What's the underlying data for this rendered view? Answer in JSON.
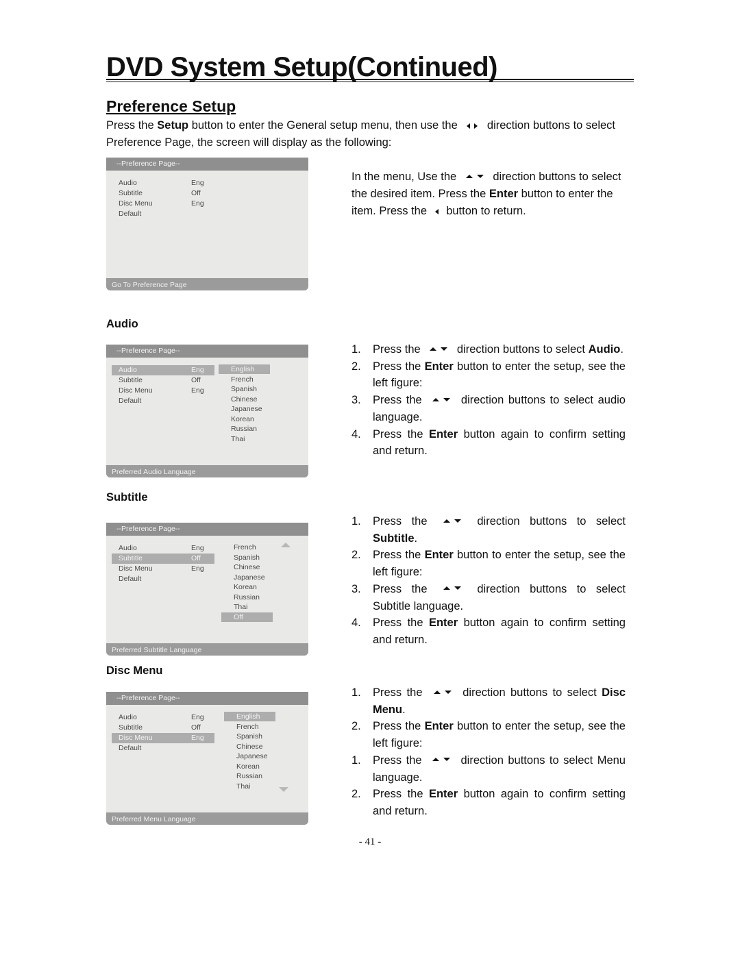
{
  "page_title": "DVD System Setup(Continued)",
  "section_title": "Preference Setup",
  "intro": {
    "part1": "Press the ",
    "bold1": "Setup",
    "part2": " button to enter the General setup menu, then use the ",
    "part3": " direction buttons to select Preference Page, the screen will display as the following:"
  },
  "right_para": {
    "part1": "In the menu, Use the ",
    "part2": " direction buttons to select the desired item. Press the ",
    "bold1": "Enter",
    "part3": " button to enter the item. Press the ",
    "part4": " button to return."
  },
  "osd_common": {
    "header": "--Preference Page--",
    "items": [
      {
        "label": "Audio",
        "value": "Eng"
      },
      {
        "label": "Subtitle",
        "value": "Off"
      },
      {
        "label": "Disc Menu",
        "value": "Eng"
      },
      {
        "label": "Default",
        "value": ""
      }
    ]
  },
  "screens": {
    "main": {
      "footer": "Go To Preference Page"
    },
    "audio": {
      "footer": "Preferred Audio Language",
      "selected_item": "Audio",
      "options": [
        "English",
        "French",
        "Spanish",
        "Chinese",
        "Japanese",
        "Korean",
        "Russian",
        "Thai"
      ],
      "selected_option": "English"
    },
    "subtitle": {
      "footer": "Preferred Subtitle Language",
      "selected_item": "Subtitle",
      "options": [
        "French",
        "Spanish",
        "Chinese",
        "Japanese",
        "Korean",
        "Russian",
        "Thai",
        "Off"
      ],
      "selected_option": "Off",
      "scroll_indicator": "scroll-up"
    },
    "disc_menu": {
      "footer": "Preferred Menu Language",
      "selected_item": "Disc Menu",
      "options": [
        "English",
        "French",
        "Spanish",
        "Chinese",
        "Japanese",
        "Korean",
        "Russian",
        "Thai"
      ],
      "selected_option": "English",
      "scroll_indicator": "scroll-down"
    }
  },
  "sections": {
    "audio": {
      "heading": "Audio",
      "steps": [
        {
          "num": "1.",
          "a": "Press the ",
          "arrows": true,
          "b": " direction buttons to select ",
          "bold": "Audio",
          "c": "."
        },
        {
          "num": "2.",
          "a": "Press the ",
          "bold": "Enter",
          "c": " button to enter the setup, see the left figure:"
        },
        {
          "num": "3.",
          "a": "Press the ",
          "arrows": true,
          "b": " direction buttons to select audio language."
        },
        {
          "num": "4.",
          "a": "Press the ",
          "bold": "Enter",
          "c": " button again to confirm setting and return."
        }
      ]
    },
    "subtitle": {
      "heading": "Subtitle",
      "steps": [
        {
          "num": "1.",
          "a": "Press the ",
          "arrows": true,
          "b": " direction buttons to select ",
          "bold": "Subtitle",
          "c": "."
        },
        {
          "num": "2.",
          "a": "Press the ",
          "bold": "Enter",
          "c": " button to enter the setup, see the left figure:"
        },
        {
          "num": "3.",
          "a": "Press the ",
          "arrows": true,
          "b": " direction buttons to select Subtitle language."
        },
        {
          "num": "4.",
          "a": "Press the ",
          "bold": "Enter",
          "c": " button again to confirm setting and return."
        }
      ]
    },
    "disc_menu": {
      "heading": "Disc Menu",
      "steps": [
        {
          "num": "1.",
          "a": "Press the ",
          "arrows": true,
          "b": " direction buttons to select ",
          "bold": "Disc Menu",
          "c": "."
        },
        {
          "num": "2.",
          "a": "Press the ",
          "bold": "Enter",
          "c": " button to enter the setup, see the left figure:"
        },
        {
          "num": "1.",
          "a": "Press the ",
          "arrows": true,
          "b": " direction buttons to select Menu language."
        },
        {
          "num": "2.",
          "a": "Press the ",
          "bold": "Enter",
          "c": " button again to confirm setting and return."
        }
      ]
    }
  },
  "page_number": "- 41 -"
}
